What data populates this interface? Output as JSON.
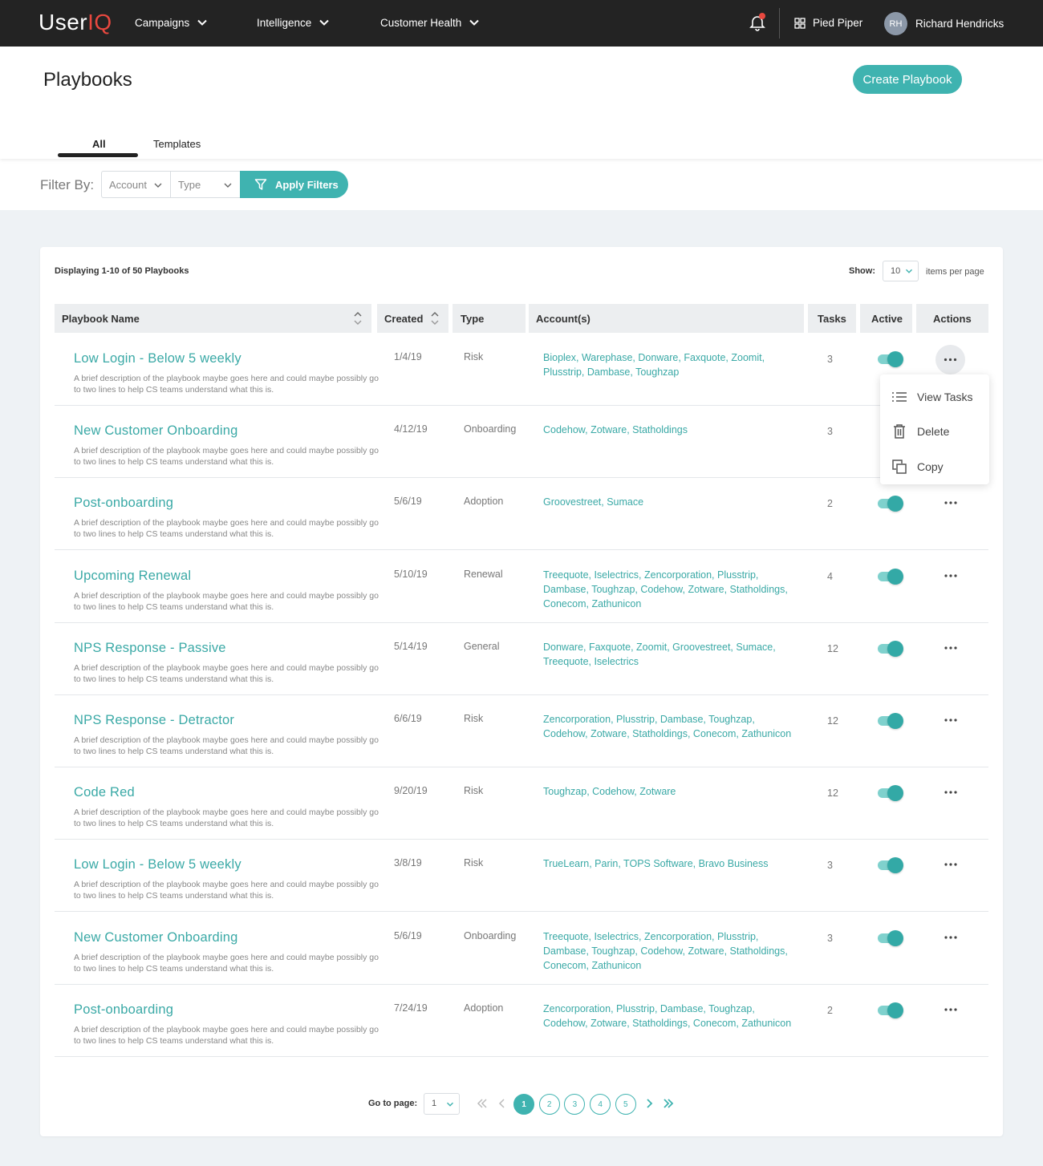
{
  "nav": {
    "logo_prefix": "User",
    "logo_suffix": "IQ",
    "items": [
      "Campaigns",
      "Intelligence",
      "Customer Health"
    ],
    "org": "Pied Piper",
    "avatar_initials": "RH",
    "user": "Richard Hendricks"
  },
  "header": {
    "title": "Playbooks",
    "create_label": "Create Playbook",
    "tabs": [
      "All",
      "Templates"
    ],
    "active_tab": "All"
  },
  "filters": {
    "label": "Filter By:",
    "account_placeholder": "Account",
    "type_placeholder": "Type",
    "apply_label": "Apply Filters"
  },
  "list": {
    "displaying": "Displaying 1-10 of 50 Playbooks",
    "show_label": "Show:",
    "per_page": "10",
    "per_page_suffix": "items per page",
    "columns": [
      "Playbook Name",
      "Created",
      "Type",
      "Account(s)",
      "Tasks",
      "Active",
      "Actions"
    ],
    "rows": [
      {
        "name": "Low Login - Below 5 weekly",
        "desc": "A brief description of the playbook maybe goes here and could maybe possibly go to two lines to help CS teams understand what this is.",
        "created": "1/4/19",
        "type": "Risk",
        "accounts": "Bioplex, Warephase, Donware, Faxquote, Zoomit, Plusstrip, Dambase, Toughzap",
        "tasks": "3",
        "active": true
      },
      {
        "name": "New Customer Onboarding",
        "desc": "A brief description of the playbook maybe goes here and could maybe possibly go to two lines to help CS teams understand what this is.",
        "created": "4/12/19",
        "type": "Onboarding",
        "accounts": "Codehow, Zotware, Statholdings",
        "tasks": "3",
        "active": true
      },
      {
        "name": "Post-onboarding",
        "desc": "A brief description of the playbook maybe goes here and could maybe possibly go to two lines to help CS teams understand what this is.",
        "created": "5/6/19",
        "type": "Adoption",
        "accounts": "Groovestreet, Sumace",
        "tasks": "2",
        "active": true
      },
      {
        "name": "Upcoming Renewal",
        "desc": "A brief description of the playbook maybe goes here and could maybe possibly go to two lines to help CS teams understand what this is.",
        "created": "5/10/19",
        "type": "Renewal",
        "accounts": "Treequote, Iselectrics, Zencorporation, Plusstrip, Dambase, Toughzap, Codehow, Zotware, Statholdings, Conecom, Zathunicon",
        "tasks": "4",
        "active": true
      },
      {
        "name": "NPS Response - Passive",
        "desc": "A brief description of the playbook maybe goes here and could maybe possibly go to two lines to help CS teams understand what this is.",
        "created": "5/14/19",
        "type": "General",
        "accounts": "Donware, Faxquote, Zoomit, Groovestreet, Sumace, Treequote, Iselectrics",
        "tasks": "12",
        "active": true
      },
      {
        "name": "NPS Response - Detractor",
        "desc": "A brief description of the playbook maybe goes here and could maybe possibly go to two lines to help CS teams understand what this is.",
        "created": "6/6/19",
        "type": "Risk",
        "accounts": "Zencorporation, Plusstrip, Dambase, Toughzap, Codehow, Zotware, Statholdings, Conecom, Zathunicon",
        "tasks": "12",
        "active": true
      },
      {
        "name": "Code Red",
        "desc": "A brief description of the playbook maybe goes here and could maybe possibly go to two lines to help CS teams understand what this is.",
        "created": "9/20/19",
        "type": "Risk",
        "accounts": "Toughzap, Codehow, Zotware",
        "tasks": "12",
        "active": true
      },
      {
        "name": "Low Login - Below 5 weekly",
        "desc": "A brief description of the playbook maybe goes here and could maybe possibly go to two lines to help CS teams understand what this is.",
        "created": "3/8/19",
        "type": "Risk",
        "accounts": "TrueLearn, Parin, TOPS Software, Bravo Business",
        "tasks": "3",
        "active": true
      },
      {
        "name": "New Customer Onboarding",
        "desc": "A brief description of the playbook maybe goes here and could maybe possibly go to two lines to help CS teams understand what this is.",
        "created": "5/6/19",
        "type": "Onboarding",
        "accounts": "Treequote, Iselectrics, Zencorporation, Plusstrip, Dambase, Toughzap, Codehow, Zotware, Statholdings, Conecom, Zathunicon",
        "tasks": "3",
        "active": true
      },
      {
        "name": "Post-onboarding",
        "desc": "A brief description of the playbook maybe goes here and could maybe possibly go to two lines to help CS teams understand what this is.",
        "created": "7/24/19",
        "type": "Adoption",
        "accounts": "Zencorporation, Plusstrip, Dambase, Toughzap, Codehow, Zotware, Statholdings, Conecom, Zathunicon",
        "tasks": "2",
        "active": true
      }
    ]
  },
  "actions_menu": {
    "items": [
      "View Tasks",
      "Delete",
      "Copy"
    ]
  },
  "pagination": {
    "goto_label": "Go to page:",
    "goto_value": "1",
    "pages": [
      "1",
      "2",
      "3",
      "4",
      "5"
    ],
    "current": "1"
  },
  "colors": {
    "accent": "#3fb3b0",
    "nav_bg": "#232323",
    "logo_accent": "#e8483f"
  }
}
